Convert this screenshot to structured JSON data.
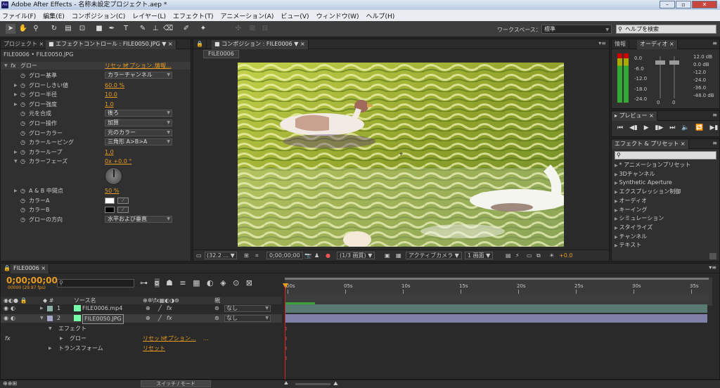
{
  "window": {
    "title": "Adobe After Effects - 名称未設定プロジェクト.aep *",
    "icon": "Ae"
  },
  "menu": [
    "ファイル(F)",
    "編集(E)",
    "コンポジション(C)",
    "レイヤー(L)",
    "エフェクト(T)",
    "アニメーション(A)",
    "ビュー(V)",
    "ウィンドウ(W)",
    "ヘルプ(H)"
  ],
  "toolbar": {
    "workspace_label": "ワークスペース：",
    "workspace_value": "標準",
    "help_placeholder": "ヘルプを検索"
  },
  "left_panel": {
    "tab_project": "プロジェクト",
    "tab_effect": "エフェクトコントロール : FILE0050.JPG",
    "subtitle": "FILE0006 • FILE0050.JPG",
    "effect_name": "グロー",
    "links": {
      "reset": "リセット",
      "options": "オプション...",
      "info": "情報..."
    },
    "props": [
      {
        "label": "グロー基準",
        "value": "カラーチャンネル",
        "kind": "dd"
      },
      {
        "label": "グローしきい値",
        "value": "60.0 %",
        "kind": "num"
      },
      {
        "label": "グロー半径",
        "value": "10.0",
        "kind": "num"
      },
      {
        "label": "グロー強度",
        "value": "1.0",
        "kind": "num"
      },
      {
        "label": "元を合成",
        "value": "後ろ",
        "kind": "dd"
      },
      {
        "label": "グロー操作",
        "value": "加算",
        "kind": "dd"
      },
      {
        "label": "グローカラー",
        "value": "元のカラー",
        "kind": "dd"
      },
      {
        "label": "カラールーピング",
        "value": "三角形 A>B>A",
        "kind": "dd"
      },
      {
        "label": "カラーループ",
        "value": "1.0",
        "kind": "num"
      },
      {
        "label": "カラーフェーズ",
        "value": "0x +0.0 °",
        "kind": "num"
      }
    ],
    "props2": [
      {
        "label": "A & B 中間点",
        "value": "50 %",
        "kind": "num"
      },
      {
        "label": "カラーA",
        "value": "",
        "kind": "swatch",
        "color": "#ffffff"
      },
      {
        "label": "カラーB",
        "value": "",
        "kind": "swatch",
        "color": "#000000"
      },
      {
        "label": "グローの方向",
        "value": "水平および垂直",
        "kind": "dd"
      }
    ]
  },
  "comp": {
    "tab": "コンポジション : FILE0006",
    "crumb": "FILE0006",
    "footer": {
      "zoom": "(32.2 ...",
      "time": "0;00;00;00",
      "resolution": "(1/3 画質)",
      "camera": "アクティブカメラ",
      "views": "1 画面",
      "exposure": "+0.0"
    }
  },
  "info_panel": {
    "tab_info": "情報",
    "tab_audio": "オーディオ",
    "db_left": [
      "0.0",
      "-6.0",
      "-12.0",
      "-18.0",
      "-24.0"
    ],
    "db_right": [
      "12.0 dB",
      "0.0 dB",
      "-12.0",
      "-24.0",
      "-36.0",
      "-48.0 dB"
    ],
    "zeros": [
      "0",
      "0"
    ]
  },
  "preview_panel": {
    "tab": "プレビュー"
  },
  "effects_panel": {
    "tab": "エフェクト & プリセット",
    "items": [
      "* アニメーションプリセット",
      "3Dチャンネル",
      "Synthetic Aperture",
      "エクスプレッション制御",
      "オーディオ",
      "キーイング",
      "シミュレーション",
      "スタイライズ",
      "チャンネル",
      "テキスト"
    ]
  },
  "timeline": {
    "tab": "FILE0006",
    "timecode": "0;00;00;00",
    "fps": "00000 (29.97 fps)",
    "source_header": "ソース名",
    "parent_header": "親",
    "ruler": [
      "00s",
      "05s",
      "10s",
      "15s",
      "20s",
      "25s",
      "30s",
      "35s"
    ],
    "layers": [
      {
        "num": "1",
        "name": "FILE0006.mp4",
        "parent": "なし",
        "color": "#8fb0a8"
      },
      {
        "num": "2",
        "name": "FILE0050.JPG",
        "parent": "なし",
        "color": "#a5a5c8"
      }
    ],
    "effects_label": "エフェクト",
    "glow_label": "グロー",
    "transform_label": "トランスフォーム",
    "reset": "リセット",
    "options": "オプション...",
    "dots": "...",
    "fx": "fx",
    "switch_mode": "スイッチ / モード"
  }
}
